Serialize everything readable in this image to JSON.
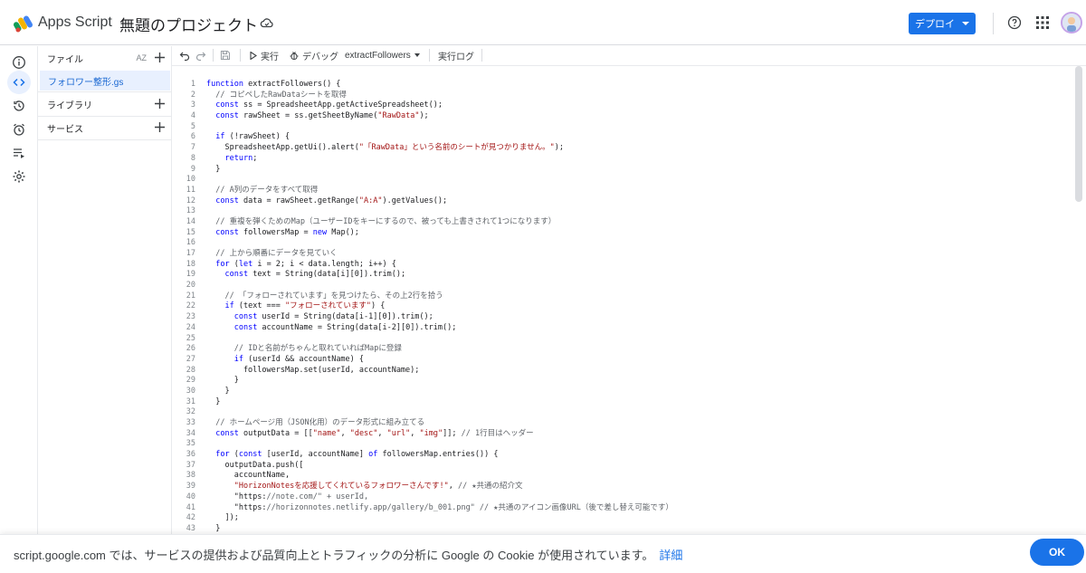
{
  "app": {
    "name": "Apps Script",
    "project_title": "無題のプロジェクト"
  },
  "header": {
    "deploy_label": "デプロイ"
  },
  "files_panel": {
    "files_label": "ファイル",
    "sort_label": "AZ",
    "active_file": "フォロワー整形.gs",
    "libraries_label": "ライブラリ",
    "services_label": "サービス"
  },
  "toolbar": {
    "run_label": "実行",
    "debug_label": "デバッグ",
    "function_select": "extractFollowers",
    "exec_log_label": "実行ログ"
  },
  "editor": {
    "line_numbers": [
      "1",
      "2",
      "3",
      "4",
      "5",
      "6",
      "7",
      "8",
      "9",
      "10",
      "11",
      "12",
      "13",
      "14",
      "15",
      "16",
      "17",
      "18",
      "19",
      "20",
      "21",
      "22",
      "23",
      "24",
      "25",
      "26",
      "27",
      "28",
      "29",
      "30",
      "31",
      "32",
      "33",
      "34",
      "35",
      "36",
      "37",
      "38",
      "39",
      "40",
      "41",
      "42",
      "43"
    ],
    "lines": [
      "function extractFollowers() {",
      "  // コピペしたRawDataシートを取得",
      "  const ss = SpreadsheetApp.getActiveSpreadsheet();",
      "  const rawSheet = ss.getSheetByName(\"RawData\");",
      "",
      "  if (!rawSheet) {",
      "    SpreadsheetApp.getUi().alert(\"「RawData」という名前のシートが見つかりません。\");",
      "    return;",
      "  }",
      "",
      "  // A列のデータをすべて取得",
      "  const data = rawSheet.getRange(\"A:A\").getValues();",
      "",
      "  // 重複を弾くためのMap（ユーザーIDをキーにするので、被っても上書きされて1つになります）",
      "  const followersMap = new Map();",
      "",
      "  // 上から順番にデータを見ていく",
      "  for (let i = 2; i < data.length; i++) {",
      "    const text = String(data[i][0]).trim();",
      "",
      "    // 「フォローされています」を見つけたら、その上2行を拾う",
      "    if (text === \"フォローされています\") {",
      "      const userId = String(data[i-1][0]).trim();",
      "      const accountName = String(data[i-2][0]).trim();",
      "",
      "      // IDと名前がちゃんと取れていればMapに登録",
      "      if (userId && accountName) {",
      "        followersMap.set(userId, accountName);",
      "      }",
      "    }",
      "  }",
      "",
      "  // ホームページ用（JSON化用）のデータ形式に組み立てる",
      "  const outputData = [[\"name\", \"desc\", \"url\", \"img\"]]; // 1行目はヘッダー",
      "",
      "  for (const [userId, accountName] of followersMap.entries()) {",
      "    outputData.push([",
      "      accountName,",
      "      \"HorizonNotesを応援してくれているフォロワーさんです!\", // ★共通の紹介文",
      "      \"https://note.com/\" + userId,",
      "      \"https://horizonnotes.netlify.app/gallery/b_001.png\" // ★共通のアイコン画像URL（後で差し替え可能です）",
      "    ]);",
      "  }"
    ]
  },
  "cookie_banner": {
    "text": "script.google.com では、サービスの提供および品質向上とトラフィックの分析に Google の Cookie が使用されています。",
    "link_label": "詳細",
    "ok_label": "OK"
  },
  "colors": {
    "accent": "#1a73e8",
    "string": "#a31515",
    "keyword": "#0000ff",
    "comment": "#5f6368"
  }
}
